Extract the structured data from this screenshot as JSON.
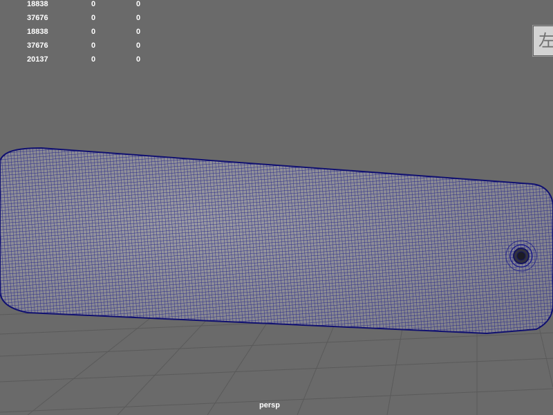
{
  "hud": {
    "rows": [
      [
        "18838",
        "0",
        "0"
      ],
      [
        "37676",
        "0",
        "0"
      ],
      [
        "18838",
        "0",
        "0"
      ],
      [
        "37676",
        "0",
        "0"
      ],
      [
        "20137",
        "0",
        "0"
      ]
    ]
  },
  "view_cube": {
    "label": "左"
  },
  "camera": {
    "name": "persp"
  },
  "colors": {
    "background": "#6a6a6a",
    "grid": "#5a5a5a",
    "mesh_fill": "#8a8a94",
    "wireframe": "#1c1c8a"
  }
}
